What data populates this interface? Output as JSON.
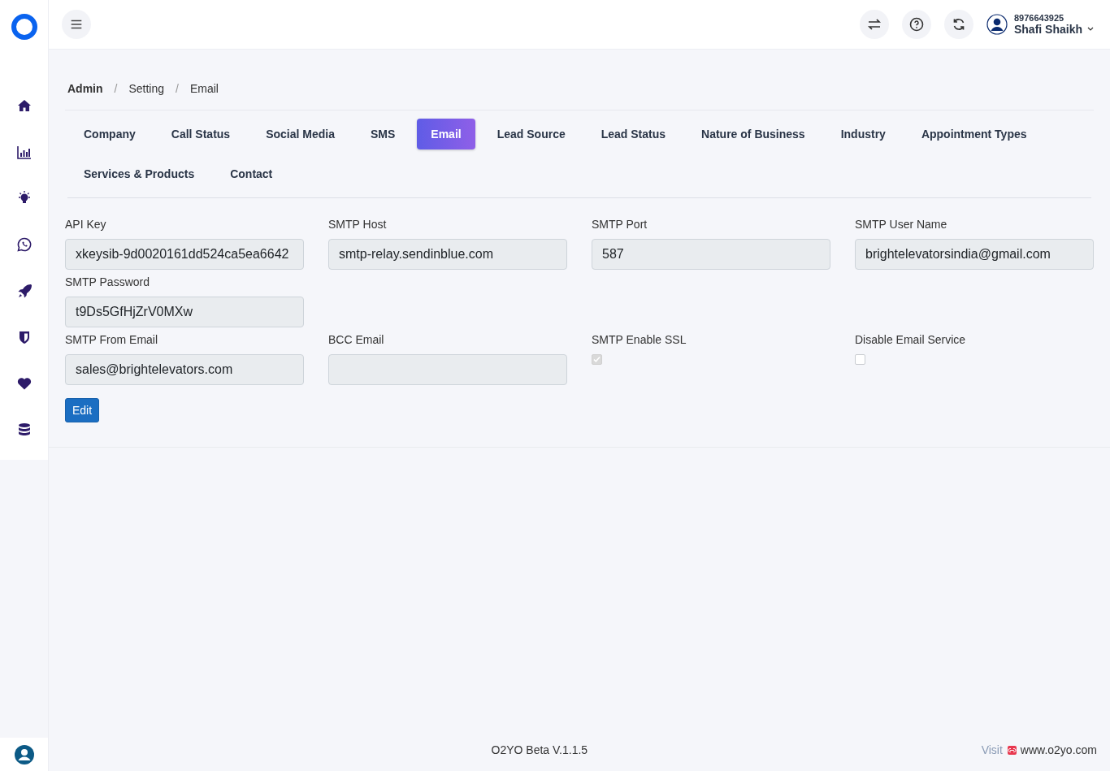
{
  "sidebar": {
    "items": [
      {
        "kind": "home"
      },
      {
        "kind": "chart"
      },
      {
        "kind": "bulb"
      },
      {
        "kind": "whatsapp"
      },
      {
        "kind": "rocket"
      },
      {
        "kind": "shield"
      },
      {
        "kind": "heart"
      },
      {
        "kind": "database"
      }
    ]
  },
  "header": {
    "phone": "8976643925",
    "user": "Shafi Shaikh"
  },
  "breadcrumb": [
    {
      "kind": "root",
      "label": "Admin"
    },
    {
      "kind": "separator",
      "label": "/"
    },
    {
      "kind": "item",
      "label": "Setting"
    },
    {
      "kind": "separator",
      "label": "/"
    },
    {
      "kind": "item",
      "label": "Email"
    }
  ],
  "tabs": [
    {
      "label": "Company",
      "selected": false
    },
    {
      "label": "Call Status",
      "selected": false
    },
    {
      "label": "Social Media",
      "selected": false
    },
    {
      "label": "SMS",
      "selected": false
    },
    {
      "label": "Email",
      "selected": true
    },
    {
      "label": "Lead Source",
      "selected": false
    },
    {
      "label": "Lead Status",
      "selected": false
    },
    {
      "label": "Nature of Business",
      "selected": false
    },
    {
      "label": "Industry",
      "selected": false
    },
    {
      "label": "Appointment Types",
      "selected": false
    },
    {
      "label": "Services & Products",
      "selected": false
    },
    {
      "label": "Contact",
      "selected": false
    }
  ],
  "form_rows": [
    [
      {
        "kind": "text",
        "label": "API Key",
        "value": "xkeysib-9d0020161dd524ca5ea6642"
      },
      {
        "kind": "text",
        "label": "SMTP Host",
        "value": "smtp-relay.sendinblue.com"
      },
      {
        "kind": "text",
        "label": "SMTP Port",
        "value": "587"
      },
      {
        "kind": "text",
        "label": "SMTP User Name",
        "value": "brightelevatorsindia@gmail.com"
      }
    ],
    [
      {
        "kind": "text",
        "label": "SMTP Password",
        "value": "t9Ds5GfHjZrV0MXw"
      }
    ],
    [
      {
        "kind": "text",
        "label": "SMTP From Email",
        "value": "sales@brightelevators.com"
      },
      {
        "kind": "text",
        "label": "BCC Email"
      },
      {
        "kind": "checkbox",
        "label": "SMTP Enable SSL",
        "checked": true
      },
      {
        "kind": "checkbox",
        "label": "Disable Email Service",
        "checked": false
      }
    ]
  ],
  "edit_button": "Edit",
  "footer": {
    "version": "O2YO Beta V.1.1.5",
    "visit": "Visit",
    "link": "www.o2yo.com"
  }
}
